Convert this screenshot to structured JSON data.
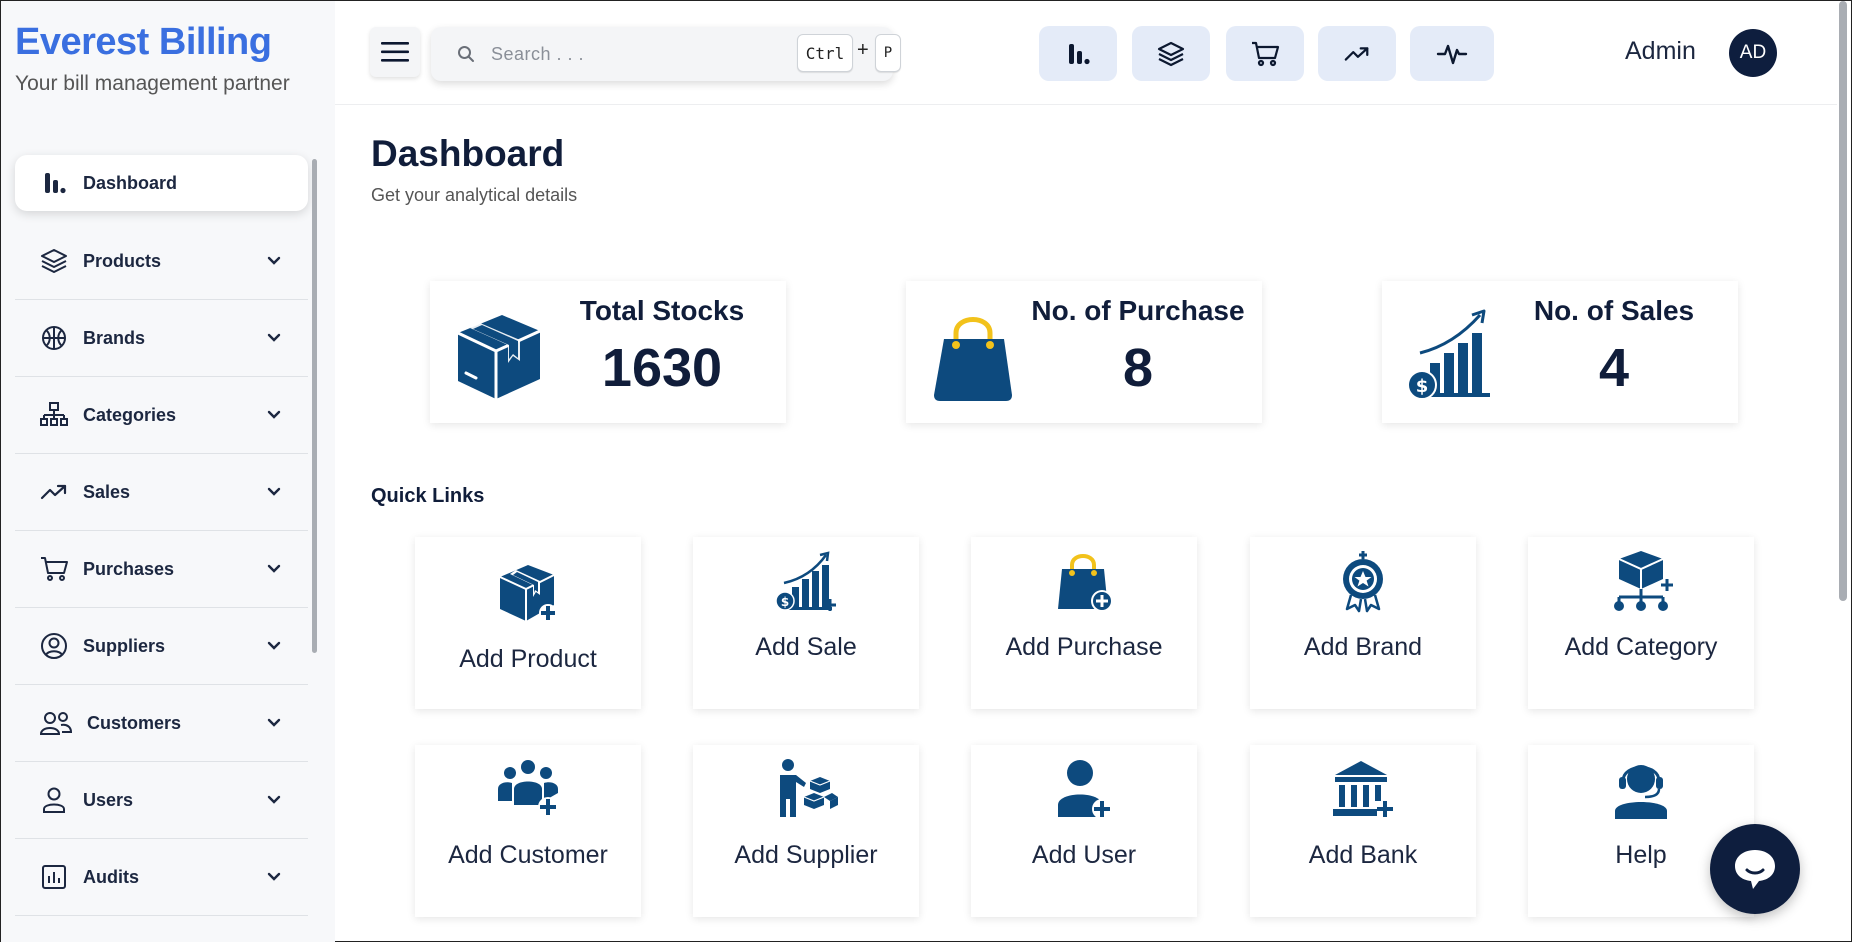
{
  "brand": {
    "title": "Everest Billing",
    "subtitle": "Your bill management partner"
  },
  "sidebar": {
    "items": [
      {
        "label": "Dashboard",
        "icon": "bar-chart-icon",
        "active": true
      },
      {
        "label": "Products",
        "icon": "layers-icon"
      },
      {
        "label": "Brands",
        "icon": "basketball-icon"
      },
      {
        "label": "Categories",
        "icon": "hierarchy-icon"
      },
      {
        "label": "Sales",
        "icon": "trend-up-icon"
      },
      {
        "label": "Purchases",
        "icon": "cart-icon"
      },
      {
        "label": "Suppliers",
        "icon": "user-circle-icon"
      },
      {
        "label": "Customers",
        "icon": "users-icon"
      },
      {
        "label": "Users",
        "icon": "user-icon"
      },
      {
        "label": "Audits",
        "icon": "audit-chart-icon"
      }
    ]
  },
  "header": {
    "search": {
      "placeholder": "Search . . .",
      "shortcut_ctrl": "Ctrl",
      "shortcut_plus": "+",
      "shortcut_key": "P"
    },
    "quick_buttons": [
      "bar-chart-icon",
      "layers-icon",
      "cart-icon",
      "trend-up-icon",
      "pulse-icon"
    ],
    "admin_name": "Admin",
    "avatar_initials": "AD"
  },
  "main": {
    "title": "Dashboard",
    "subtitle": "Get your analytical details",
    "stats": [
      {
        "label": "Total Stocks",
        "value": "1630",
        "icon": "box-icon"
      },
      {
        "label": "No. of Purchase",
        "value": "8",
        "icon": "shopping-bag-icon"
      },
      {
        "label": "No. of Sales",
        "value": "4",
        "icon": "sales-growth-icon"
      }
    ],
    "quick_links_title": "Quick Links",
    "quick_links": [
      {
        "label": "Add Product",
        "icon": "add-product-icon"
      },
      {
        "label": "Add Sale",
        "icon": "add-sale-icon"
      },
      {
        "label": "Add Purchase",
        "icon": "add-purchase-icon"
      },
      {
        "label": "Add Brand",
        "icon": "add-brand-icon"
      },
      {
        "label": "Add Category",
        "icon": "add-category-icon"
      },
      {
        "label": "Add Customer",
        "icon": "add-customer-icon"
      },
      {
        "label": "Add Supplier",
        "icon": "add-supplier-icon"
      },
      {
        "label": "Add User",
        "icon": "add-user-icon"
      },
      {
        "label": "Add Bank",
        "icon": "add-bank-icon"
      },
      {
        "label": "Help",
        "icon": "help-headset-icon"
      }
    ]
  },
  "colors": {
    "brand": "#3a6fe0",
    "navy": "#0e1e3e",
    "icon_blue": "#0d4a7e",
    "accent_yellow": "#f2c21b",
    "header_button_bg": "#e4ebf8"
  }
}
